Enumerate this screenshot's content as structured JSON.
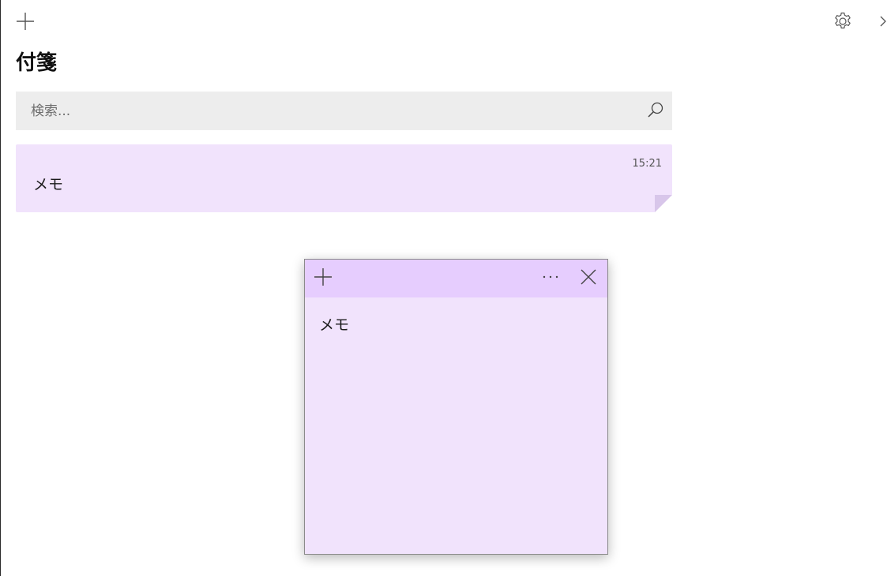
{
  "app": {
    "title": "付箋"
  },
  "toolbar": {
    "new_note_icon": "plus-icon",
    "settings_icon": "gear-icon",
    "close_icon": "chevron-right-icon"
  },
  "search": {
    "placeholder": "検索...",
    "value": "",
    "icon": "search-icon"
  },
  "notes": [
    {
      "text": "メモ",
      "time": "15:21",
      "color": "#f1e3fc"
    }
  ],
  "sticky_window": {
    "header_color": "#e6cdfe",
    "body_color": "#f1e3fc",
    "add_icon": "plus-icon",
    "menu_icon": "ellipsis-icon",
    "close_icon": "close-icon",
    "content": "メモ"
  }
}
